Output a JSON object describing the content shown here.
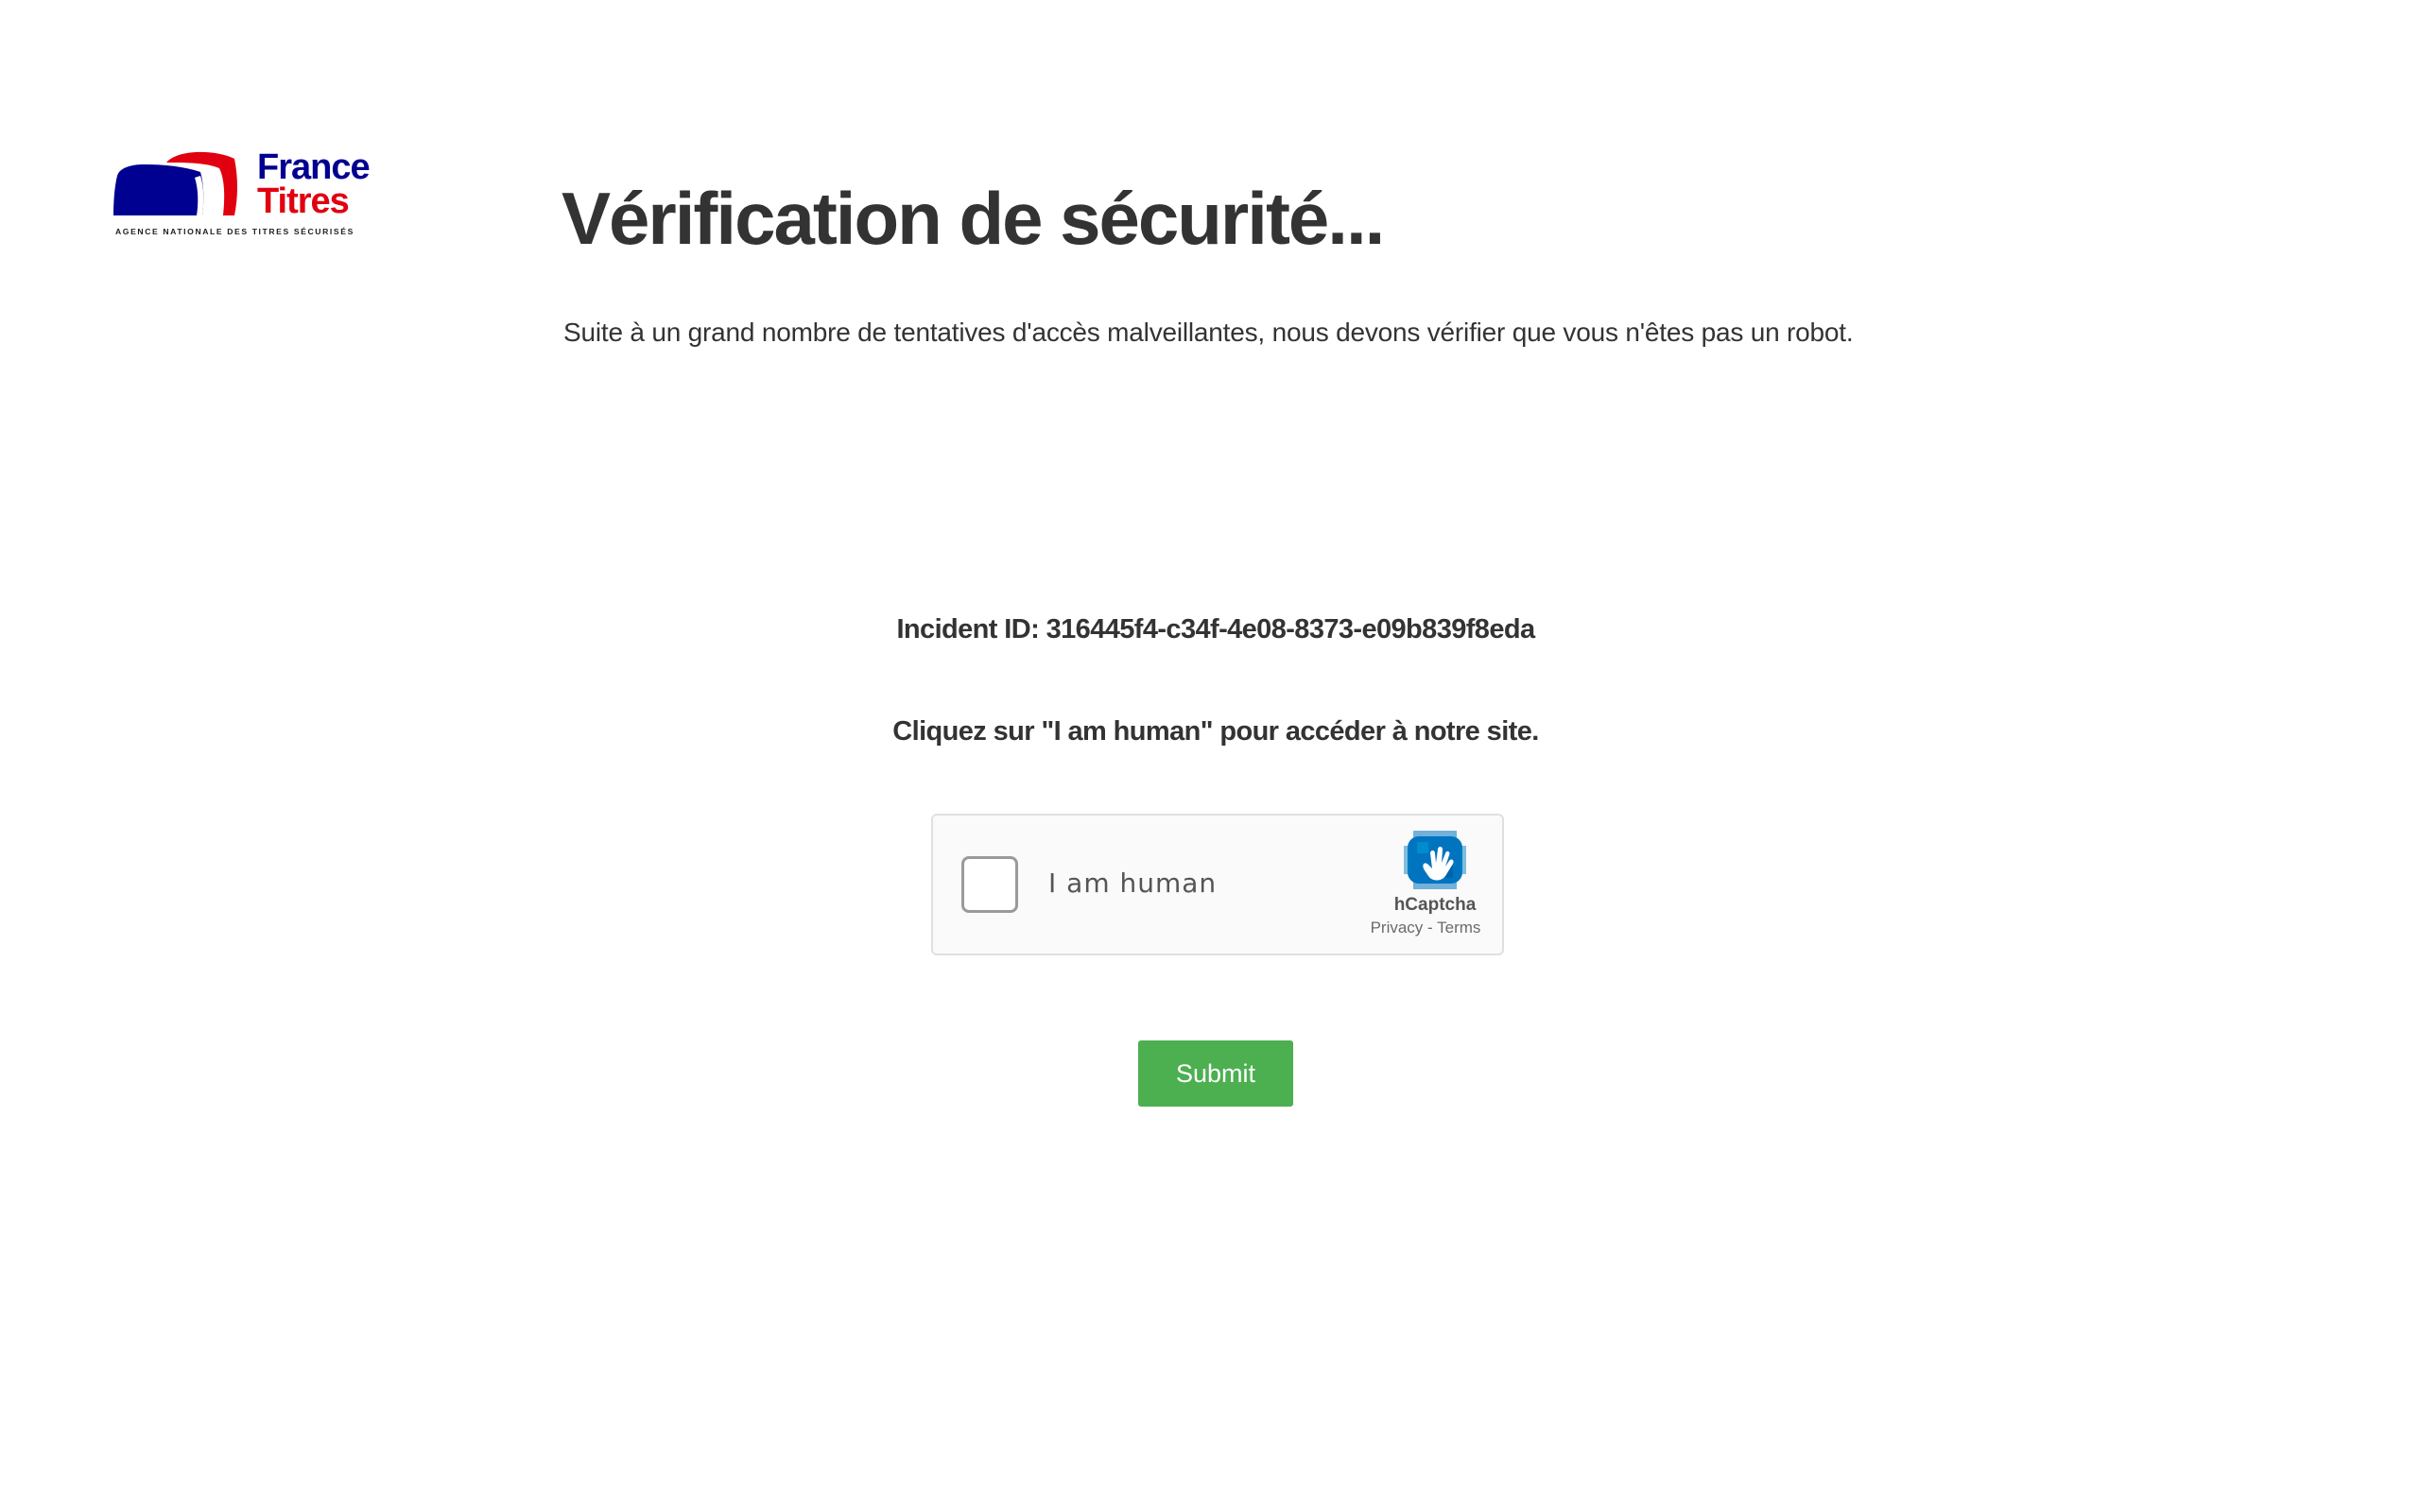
{
  "logo": {
    "line1": "France",
    "line2": "Titres",
    "tagline": "AGENCE NATIONALE DES TITRES SÉCURISÉS",
    "colors": {
      "blue": "#000091",
      "red": "#e1000f"
    }
  },
  "heading": {
    "title": "Vérification de sécurité...",
    "subtitle": "Suite à un grand nombre de tentatives d'accès malveillantes, nous devons vérifier que vous n'êtes pas un robot."
  },
  "incident": {
    "text": "Incident ID: 316445f4-c34f-4e08-8373-e09b839f8eda"
  },
  "instruction": {
    "text": "Cliquez sur \"I am human\" pour accéder à notre site."
  },
  "captcha": {
    "checkbox_label": "I am human",
    "brand": "hCaptcha",
    "privacy_link": "Privacy",
    "separator": " - ",
    "terms_link": "Terms",
    "icon": "hcaptcha-hand-icon",
    "colors": {
      "background": "#fafafa",
      "border": "#e0e0e0",
      "accent": "#0074bf"
    }
  },
  "form": {
    "submit_label": "Submit",
    "colors": {
      "submit_bg": "#4caf50",
      "submit_text": "#ffffff"
    }
  }
}
